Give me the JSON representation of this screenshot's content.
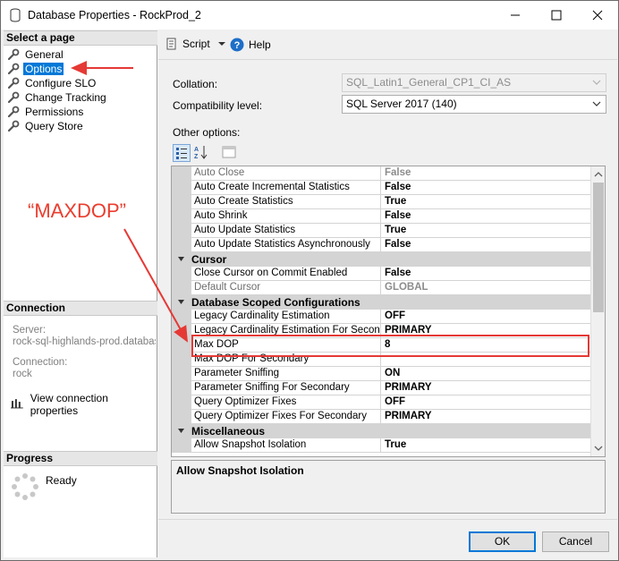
{
  "window": {
    "title": "Database Properties - RockProd_2"
  },
  "sidebar": {
    "select_page_header": "Select a page",
    "items": [
      {
        "label": "General"
      },
      {
        "label": "Options"
      },
      {
        "label": "Configure SLO"
      },
      {
        "label": "Change Tracking"
      },
      {
        "label": "Permissions"
      },
      {
        "label": "Query Store"
      }
    ],
    "selected_index": 1,
    "connection_header": "Connection",
    "server_label": "Server:",
    "server_value": "rock-sql-highlands-prod.database.w",
    "connection_label": "Connection:",
    "connection_value": "rock",
    "view_connection": "View connection properties",
    "progress_header": "Progress",
    "progress_status": "Ready"
  },
  "toolbar": {
    "script_label": "Script",
    "help_label": "Help"
  },
  "form": {
    "collation_label": "Collation:",
    "collation_value": "SQL_Latin1_General_CP1_CI_AS",
    "compat_label": "Compatibility level:",
    "compat_value": "SQL Server 2017 (140)",
    "other_options_label": "Other options:"
  },
  "grid": {
    "rows": [
      {
        "type": "prop",
        "name": "Auto Close",
        "value": "False",
        "dim": true
      },
      {
        "type": "prop",
        "name": "Auto Create Incremental Statistics",
        "value": "False"
      },
      {
        "type": "prop",
        "name": "Auto Create Statistics",
        "value": "True"
      },
      {
        "type": "prop",
        "name": "Auto Shrink",
        "value": "False"
      },
      {
        "type": "prop",
        "name": "Auto Update Statistics",
        "value": "True"
      },
      {
        "type": "prop",
        "name": "Auto Update Statistics Asynchronously",
        "value": "False"
      },
      {
        "type": "cat",
        "name": "Cursor"
      },
      {
        "type": "prop",
        "name": "Close Cursor on Commit Enabled",
        "value": "False"
      },
      {
        "type": "prop",
        "name": "Default Cursor",
        "value": "GLOBAL",
        "dim": true
      },
      {
        "type": "cat",
        "name": "Database Scoped Configurations"
      },
      {
        "type": "prop",
        "name": "Legacy Cardinality Estimation",
        "value": "OFF"
      },
      {
        "type": "prop",
        "name": "Legacy Cardinality Estimation For Secondary",
        "value": "PRIMARY"
      },
      {
        "type": "prop",
        "name": "Max DOP",
        "value": "8"
      },
      {
        "type": "prop",
        "name": "Max DOP For Secondary",
        "value": ""
      },
      {
        "type": "prop",
        "name": "Parameter Sniffing",
        "value": "ON"
      },
      {
        "type": "prop",
        "name": "Parameter Sniffing For Secondary",
        "value": "PRIMARY"
      },
      {
        "type": "prop",
        "name": "Query Optimizer Fixes",
        "value": "OFF"
      },
      {
        "type": "prop",
        "name": "Query Optimizer Fixes For Secondary",
        "value": "PRIMARY"
      },
      {
        "type": "cat",
        "name": "Miscellaneous"
      },
      {
        "type": "prop",
        "name": "Allow Snapshot Isolation",
        "value": "True"
      }
    ],
    "description_title": "Allow Snapshot Isolation"
  },
  "buttons": {
    "ok": "OK",
    "cancel": "Cancel"
  },
  "annotation": {
    "text": "“MAXDOP”",
    "color": "#ea3d2e"
  }
}
